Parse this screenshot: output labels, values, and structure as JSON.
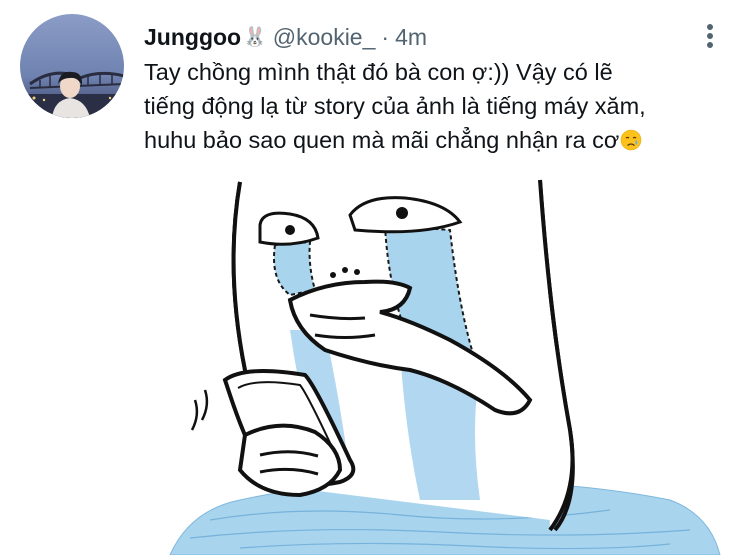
{
  "tweet": {
    "display_name": "Junggoo",
    "name_emoji": "🐰",
    "handle": "@kookie_",
    "separator": "·",
    "time": "4m",
    "text_lines": [
      "Tay chồng mình thật đó bà con ợ:)) Vậy có lẽ",
      "tiếng động lạ từ story của ảnh là tiếng máy xăm,",
      "huhu bảo sao quen mà mãi chẳng nhận ra cơ"
    ],
    "text_emoji": "crying-face-emoji"
  },
  "icons": {
    "more": "more-options-icon",
    "avatar": "profile-avatar",
    "media": "crying-meme-drawing"
  },
  "colors": {
    "text_primary": "#0f1419",
    "text_secondary": "#536471",
    "tear_blue": "#a8d4ee",
    "avatar_sky": "#7a8fb8"
  }
}
